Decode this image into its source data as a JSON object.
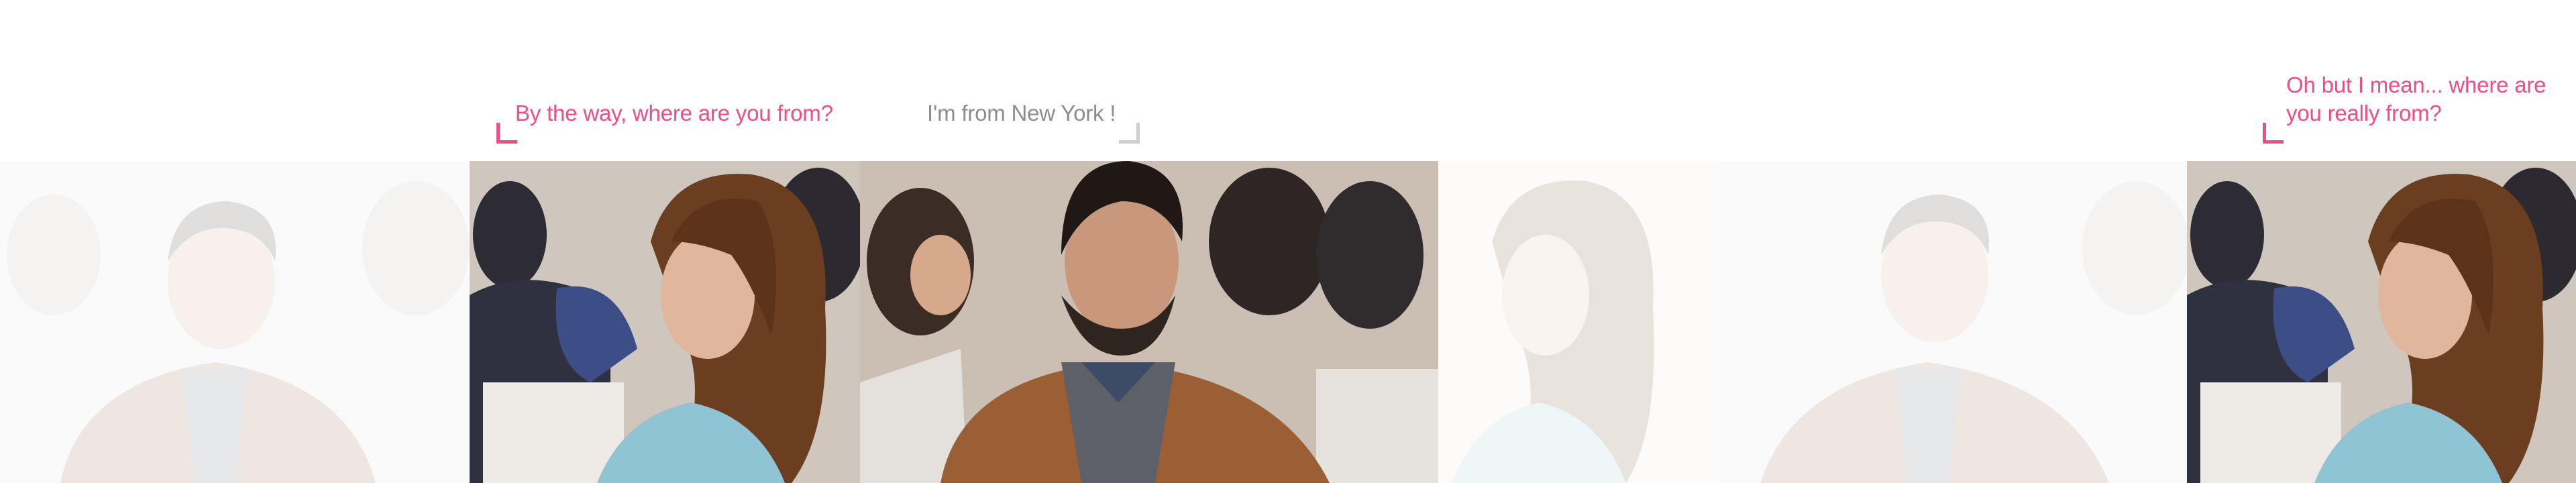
{
  "dialogue": {
    "q1": "By the way, where are you from?",
    "a1": "I'm from New York !",
    "q2": "Oh but I mean... where are you really from?"
  },
  "colors": {
    "accent_pink": "#ee4d8a",
    "reply_grey": "#8d8d8d",
    "bracket_grey": "#cfcfcf"
  }
}
